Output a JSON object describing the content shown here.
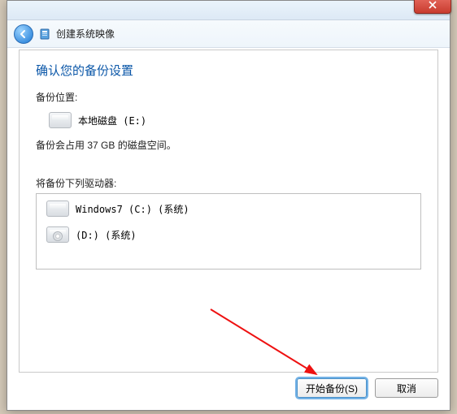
{
  "window": {
    "title": "创建系统映像"
  },
  "content": {
    "heading": "确认您的备份设置",
    "backup_location_label": "备份位置:",
    "backup_location_value": "本地磁盘 (E:)",
    "size_text": "备份会占用 37 GB 的磁盘空间。",
    "drives_label": "将备份下列驱动器:",
    "drives": [
      {
        "label": "Windows7 (C:) (系统)"
      },
      {
        "label": "(D:) (系统)"
      }
    ]
  },
  "buttons": {
    "start": "开始备份(S)",
    "cancel": "取消"
  }
}
